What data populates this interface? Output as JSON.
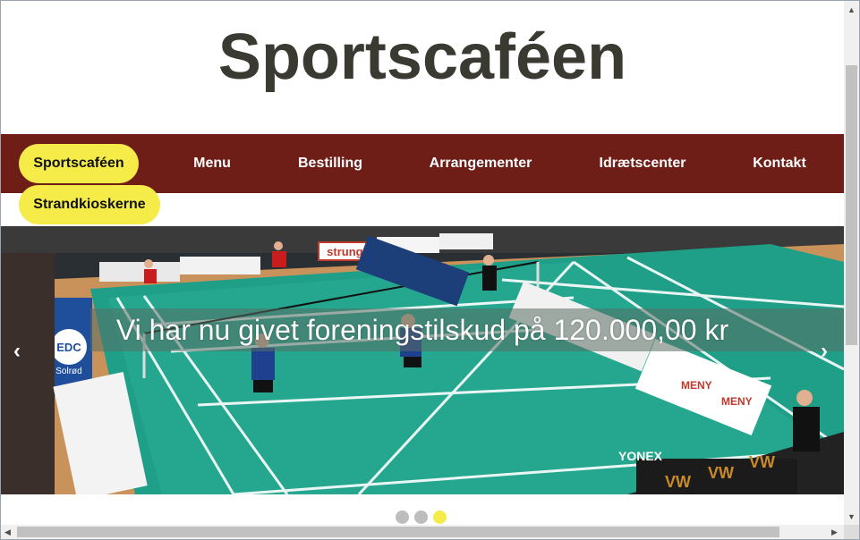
{
  "site": {
    "title": "Sportscaféen"
  },
  "nav": {
    "items": [
      {
        "label": "Sportscaféen",
        "active": true
      },
      {
        "label": "Menu"
      },
      {
        "label": "Bestilling"
      },
      {
        "label": "Arrangementer"
      },
      {
        "label": "Idrætscenter"
      },
      {
        "label": "Kontakt"
      },
      {
        "label": "Strandkioskerne",
        "active": true
      }
    ]
  },
  "slider": {
    "caption": "Vi har nu givet foreningstilskud på 120.000,00 kr",
    "prev": "‹",
    "next": "›",
    "dots": [
      {
        "active": false
      },
      {
        "active": false
      },
      {
        "active": true
      }
    ],
    "banners": [
      "strunge",
      "YONEX",
      "EDC",
      "Solrød",
      "MENY",
      "MENY",
      "VW",
      "VW",
      "VW",
      "YONEX"
    ]
  },
  "colors": {
    "nav_bg": "#6e1d17",
    "pill": "#f5ec4a",
    "court": "#1f9e88",
    "dot_active": "#f5ec4a",
    "dot_inactive": "#bdbdbd"
  },
  "scrollbars": {
    "up": "▲",
    "down": "▼",
    "left": "◀",
    "right": "▶"
  }
}
